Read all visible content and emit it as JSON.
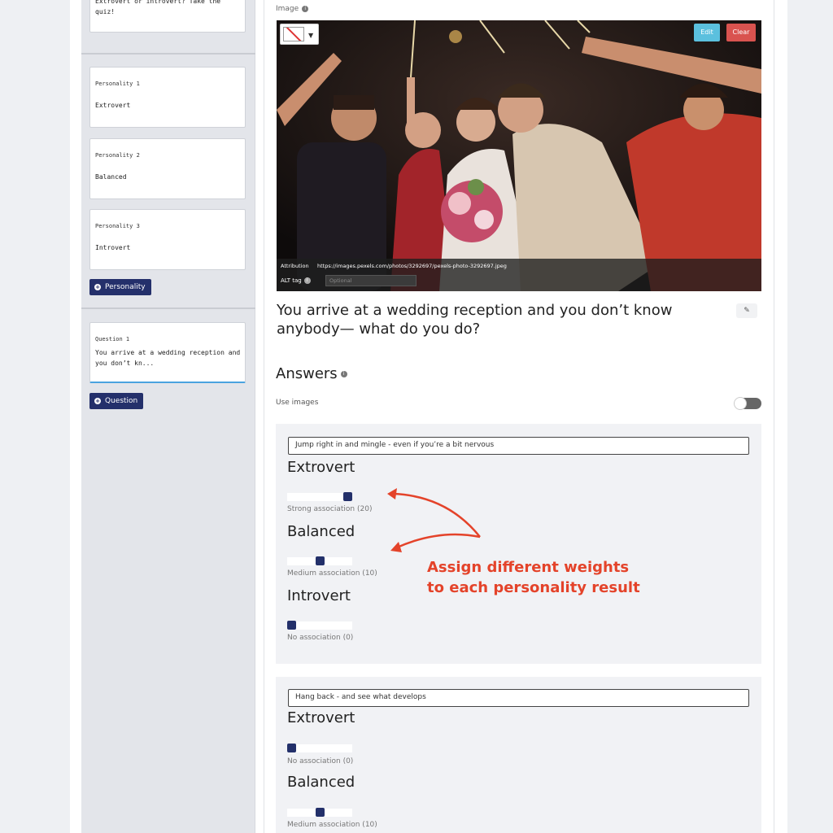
{
  "sidebar": {
    "intro_text": "Extrovert or introvert? Take the quiz!",
    "personalities": [
      {
        "caption": "Personality 1",
        "value": "Extrovert"
      },
      {
        "caption": "Personality 2",
        "value": "Balanced"
      },
      {
        "caption": "Personality 3",
        "value": "Introvert"
      }
    ],
    "add_personality_label": "Personality",
    "questions": [
      {
        "caption": "Question 1",
        "value": "You arrive at a wedding reception and you don’t kn..."
      }
    ],
    "add_question_label": "Question"
  },
  "image_section": {
    "label": "Image",
    "edit_label": "Edit",
    "clear_label": "Clear",
    "attribution_label": "Attribution",
    "attribution_value": "https://images.pexels.com/photos/3292697/pexels-photo-3292697.jpeg",
    "alt_label": "ALT tag",
    "alt_placeholder": "Optional"
  },
  "question_text": "You arrive at a wedding reception and you don’t know anybody— what do you do?",
  "answers_title": "Answers",
  "use_images_label": "Use images",
  "answers": [
    {
      "text": "Jump right in and mingle - even if you’re a bit nervous",
      "weights": [
        {
          "personality": "Extrovert",
          "level": 20,
          "label": "Strong association (20)"
        },
        {
          "personality": "Balanced",
          "level": 10,
          "label": "Medium association (10)"
        },
        {
          "personality": "Introvert",
          "level": 0,
          "label": "No association (0)"
        }
      ]
    },
    {
      "text": "Hang back - and see what develops",
      "weights": [
        {
          "personality": "Extrovert",
          "level": 0,
          "label": "No association (0)"
        },
        {
          "personality": "Balanced",
          "level": 10,
          "label": "Medium association (10)"
        }
      ]
    }
  ],
  "annotation": {
    "line1": "Assign different weights",
    "line2": "to each personality result"
  },
  "colors": {
    "accent": "#24306b",
    "annotation": "#e4432a",
    "edit": "#5bc0de",
    "clear": "#d9534f"
  }
}
